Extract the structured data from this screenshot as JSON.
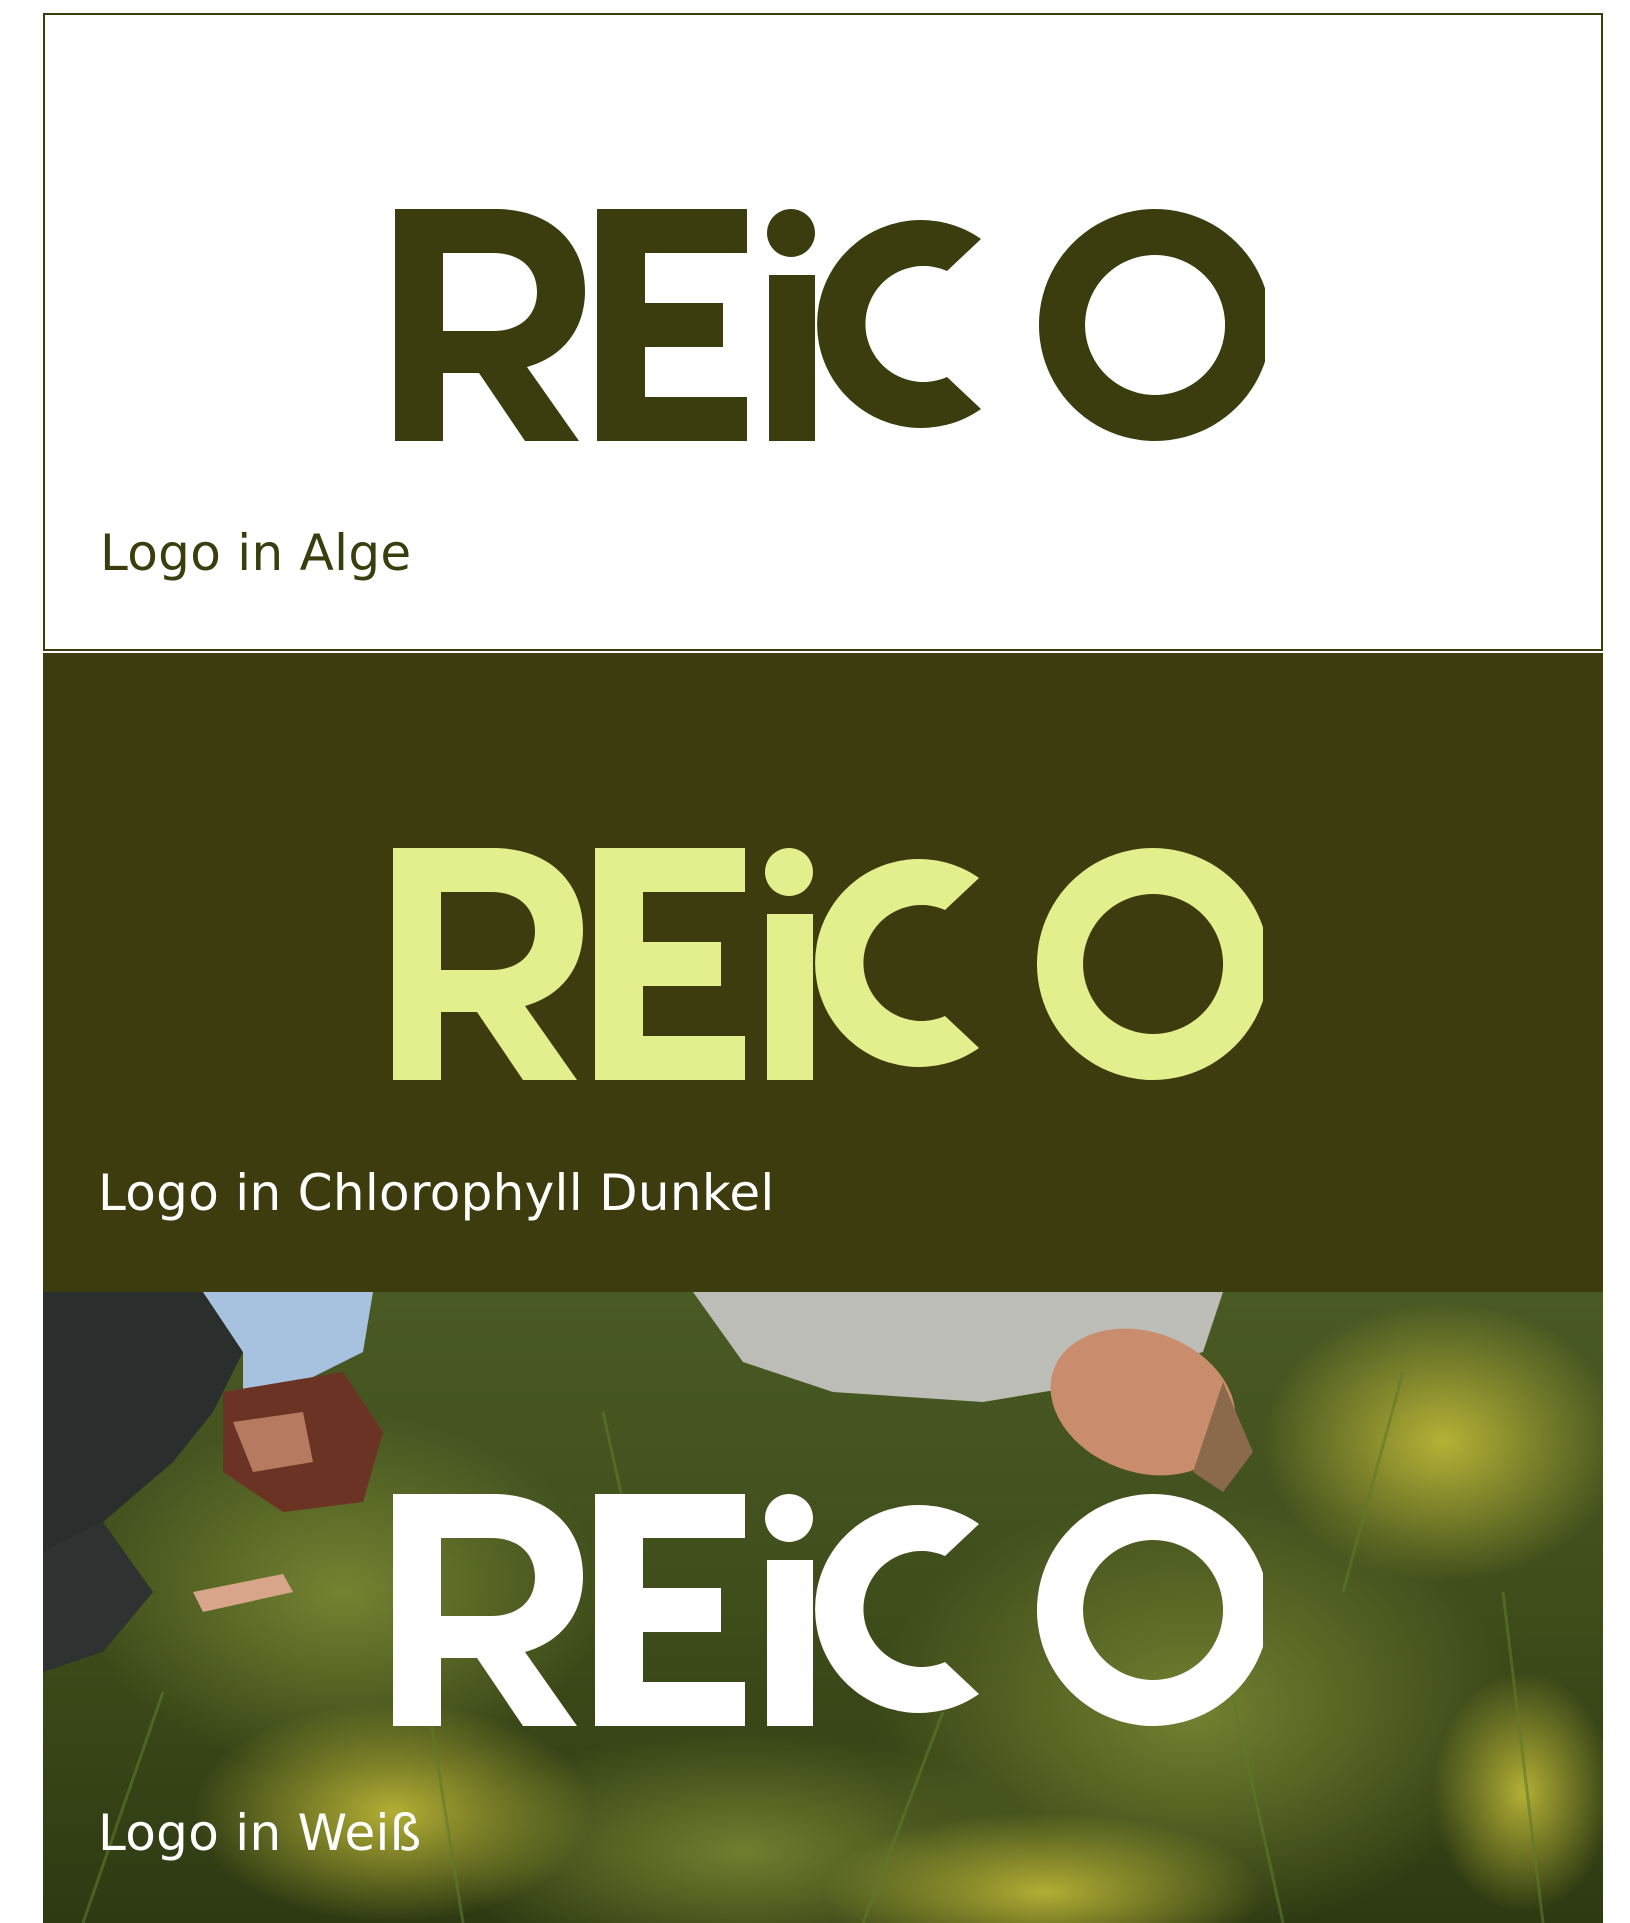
{
  "colors": {
    "alge": "#3b3d0f",
    "chlorophyll_dunkel": "#3d3c0e",
    "chlorophyll_hell": "#e3ee8c",
    "weiss": "#ffffff"
  },
  "panels": [
    {
      "logo_text": "REiCO",
      "caption": "Logo in Alge",
      "logo_color": "#3b3d0f",
      "caption_color": "#3b3d0f"
    },
    {
      "logo_text": "REiCO",
      "caption": "Logo in Chlorophyll Dunkel",
      "logo_color": "#e3ee8c",
      "caption_color": "#ffffff"
    },
    {
      "logo_text": "REiCO",
      "caption": "Logo in Weiß",
      "logo_color": "#ffffff",
      "caption_color": "#ffffff"
    }
  ]
}
